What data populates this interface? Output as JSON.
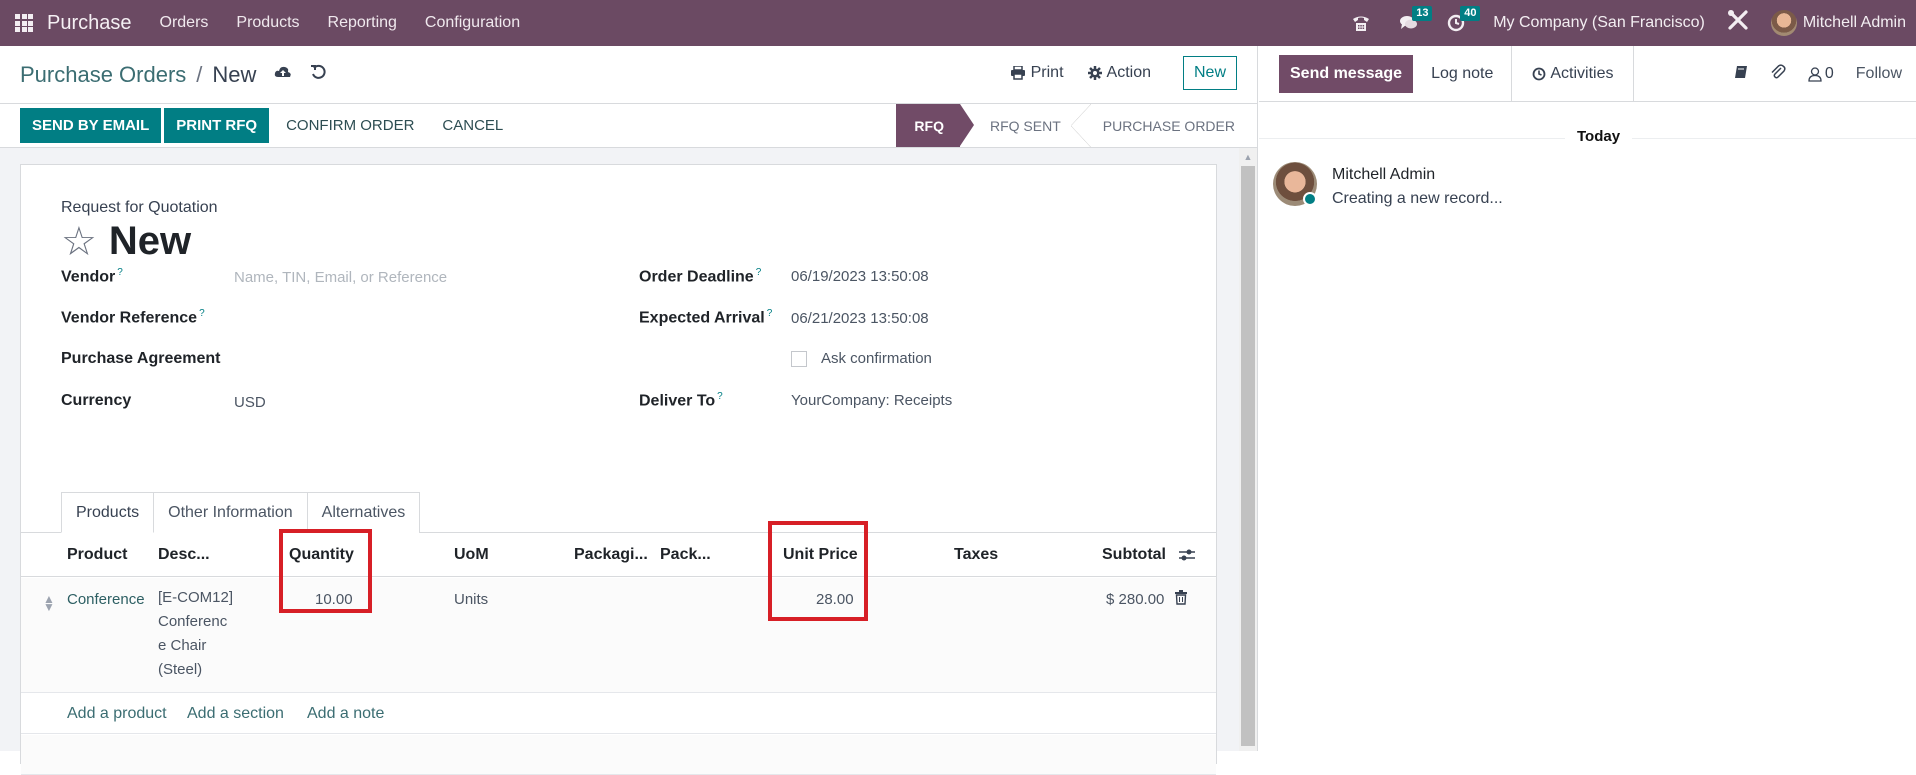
{
  "navbar": {
    "app_name": "Purchase",
    "menus": [
      "Orders",
      "Products",
      "Reporting",
      "Configuration"
    ],
    "icons": [
      "phone-icon",
      "chat-icon",
      "clock-icon",
      "tools-icon"
    ],
    "messages_badge": "13",
    "activities_badge": "40",
    "company": "My Company (San Francisco)",
    "user": "Mitchell Admin"
  },
  "control_panel": {
    "breadcrumb_parent": "Purchase Orders",
    "breadcrumb_separator": "/",
    "breadcrumb_current": "New",
    "print_label": "Print",
    "action_label": "Action",
    "new_label": "New"
  },
  "status_bar": {
    "buttons": [
      "SEND BY EMAIL",
      "PRINT RFQ"
    ],
    "secondary_buttons": [
      "CONFIRM ORDER",
      "CANCEL"
    ],
    "stages": [
      "RFQ",
      "RFQ SENT",
      "PURCHASE ORDER"
    ],
    "active_stage": "RFQ"
  },
  "form": {
    "record_type": "Request for Quotation",
    "title": "New",
    "left_fields": [
      {
        "label": "Vendor",
        "help": "?",
        "value": "",
        "placeholder": "Name, TIN, Email, or Reference"
      },
      {
        "label": "Vendor Reference",
        "help": "?",
        "value": ""
      },
      {
        "label": "Purchase Agreement",
        "value": ""
      },
      {
        "label": "Currency",
        "value": "USD"
      }
    ],
    "right_fields": [
      {
        "label": "Order Deadline",
        "help": "?",
        "value": "06/19/2023 13:50:08"
      },
      {
        "label": "Expected Arrival",
        "help": "?",
        "value": "06/21/2023 13:50:08"
      },
      {
        "label": "",
        "checkbox_label": "Ask confirmation",
        "checked": false
      },
      {
        "label": "Deliver To",
        "help": "?",
        "value": "YourCompany: Receipts"
      }
    ],
    "tabs": [
      "Products",
      "Other Information",
      "Alternatives"
    ],
    "active_tab": "Products"
  },
  "order_lines": {
    "columns": [
      "Product",
      "Desc...",
      "Quantity",
      "UoM",
      "Packagi...",
      "Pack...",
      "Unit Price",
      "Taxes",
      "Subtotal"
    ],
    "rows": [
      {
        "product": "Conference",
        "description_lines": [
          "[E-COM12]",
          "Conferenc",
          "e Chair",
          "(Steel)"
        ],
        "quantity": "10.00",
        "uom": "Units",
        "packaging": "",
        "pack_qty": "",
        "unit_price": "28.00",
        "taxes": "",
        "subtotal": "$ 280.00"
      }
    ],
    "add_links": [
      "Add a product",
      "Add a section",
      "Add a note"
    ]
  },
  "chatter": {
    "send_message": "Send message",
    "log_note": "Log note",
    "activities": "Activities",
    "followers_count": "0",
    "follow": "Follow",
    "date_separator": "Today",
    "messages": [
      {
        "author": "Mitchell Admin",
        "body": "Creating a new record..."
      }
    ]
  },
  "colors": {
    "brand": "#714b67",
    "primary": "#017e84",
    "highlight": "#d71f26"
  }
}
